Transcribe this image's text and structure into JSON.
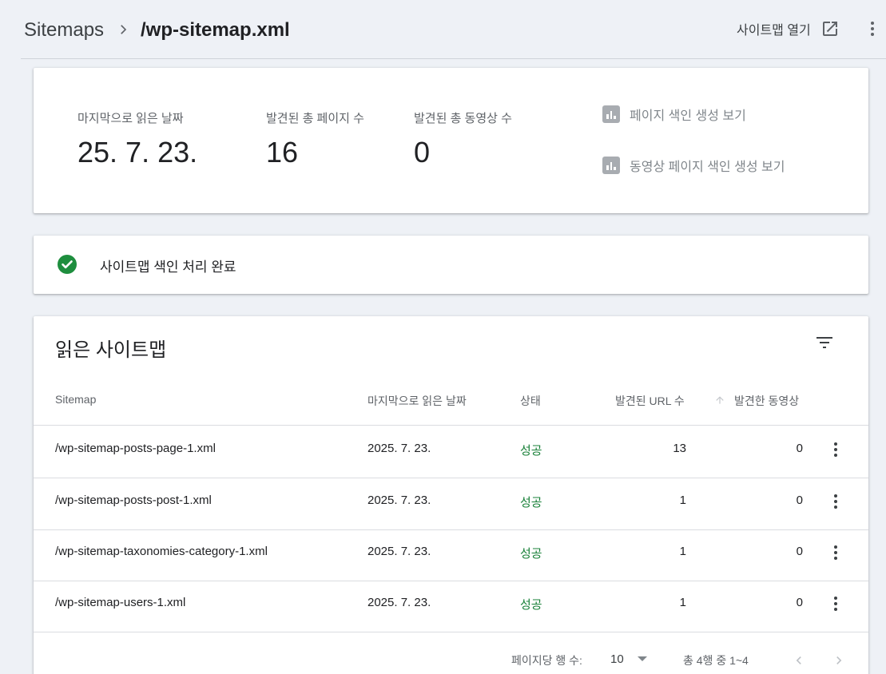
{
  "header": {
    "breadcrumb_root": "Sitemaps",
    "breadcrumb_current": "/wp-sitemap.xml",
    "open_sitemap_label": "사이트맵 열기"
  },
  "stats": {
    "last_read_label": "마지막으로 읽은 날짜",
    "last_read_value": "25. 7. 23.",
    "pages_label": "발견된 총 페이지 수",
    "pages_value": "16",
    "videos_label": "발견된 총 동영상 수",
    "videos_value": "0",
    "page_index_link": "페이지 색인 생성 보기",
    "video_index_link": "동영상 페이지 색인 생성 보기"
  },
  "status": {
    "message": "사이트맵 색인 처리 완료",
    "color": "#1e8e3e"
  },
  "table": {
    "title": "읽은 사이트맵",
    "columns": {
      "sitemap": "Sitemap",
      "last_read": "마지막으로 읽은 날짜",
      "status": "상태",
      "urls": "발견된 URL 수",
      "videos": "발견한 동영상"
    },
    "rows": [
      {
        "sitemap": "/wp-sitemap-posts-page-1.xml",
        "last_read": "2025. 7. 23.",
        "status": "성공",
        "urls": "13",
        "videos": "0"
      },
      {
        "sitemap": "/wp-sitemap-posts-post-1.xml",
        "last_read": "2025. 7. 23.",
        "status": "성공",
        "urls": "1",
        "videos": "0"
      },
      {
        "sitemap": "/wp-sitemap-taxonomies-category-1.xml",
        "last_read": "2025. 7. 23.",
        "status": "성공",
        "urls": "1",
        "videos": "0"
      },
      {
        "sitemap": "/wp-sitemap-users-1.xml",
        "last_read": "2025. 7. 23.",
        "status": "성공",
        "urls": "1",
        "videos": "0"
      }
    ],
    "pagination": {
      "rows_per_page_label": "페이지당 행 수:",
      "rows_per_page_value": "10",
      "range_text": "총 4행 중 1~4"
    }
  }
}
